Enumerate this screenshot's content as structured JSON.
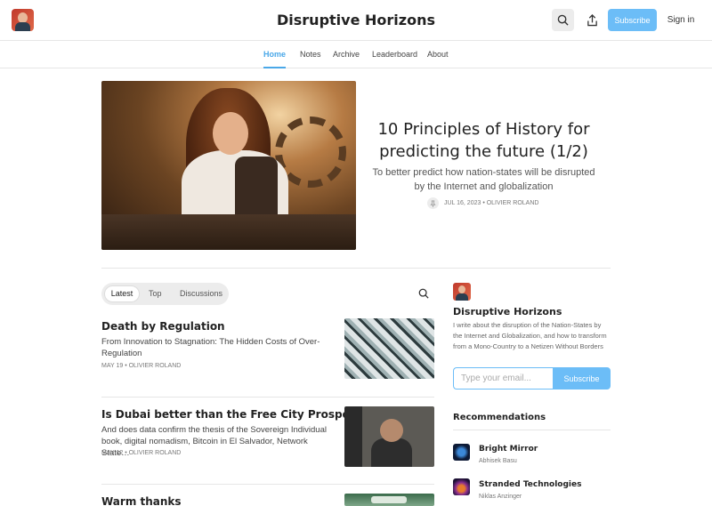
{
  "header": {
    "title": "Disruptive Horizons",
    "subscribe_label": "Subscribe",
    "signin_label": "Sign in",
    "icons": [
      "avatar",
      "search-icon",
      "share-icon"
    ]
  },
  "nav": {
    "items": [
      {
        "label": "Home",
        "active": true
      },
      {
        "label": "Notes"
      },
      {
        "label": "Archive"
      },
      {
        "label": "Leaderboard"
      },
      {
        "label": "About"
      }
    ]
  },
  "hero": {
    "title": "10 Principles of History for predicting the future (1/2)",
    "subtitle": "To better predict how nation-states will be disrupted by the Internet and globalization",
    "meta": "JUL 16, 2023 • OLIVIER ROLAND"
  },
  "tabs": {
    "items": [
      {
        "label": "Latest",
        "active": true
      },
      {
        "label": "Top"
      },
      {
        "label": "Discussions"
      }
    ]
  },
  "posts": [
    {
      "title": "Death by Regulation",
      "subtitle": "From Innovation to Stagnation: The Hidden Costs of Over-Regulation",
      "meta": "MAY 19 • OLIVIER ROLAND"
    },
    {
      "title": "Is Dubai better than the Free City Prospera ?",
      "subtitle": "And does data confirm the thesis of the Sovereign Individual book, digital nomadism, Bitcoin in El Salvador, Network State…",
      "meta": "MAY 12 • OLIVIER ROLAND"
    },
    {
      "title": "Warm thanks"
    }
  ],
  "sidebar": {
    "title": "Disruptive Horizons",
    "description": "I write about the disruption of the Nation-States by the Internet and Globalization, and how to transform from a Mono-Country to a Netizen Without Borders",
    "email_placeholder": "Type your email...",
    "subscribe_label": "Subscribe",
    "recommendations_heading": "Recommendations",
    "recommendations": [
      {
        "name": "Bright Mirror",
        "author": "Abhisek Basu"
      },
      {
        "name": "Stranded Technologies",
        "author": "Niklas Anzinger"
      }
    ]
  },
  "colors": {
    "accent": "#4aa8e8",
    "button": "#6cbdf7"
  }
}
